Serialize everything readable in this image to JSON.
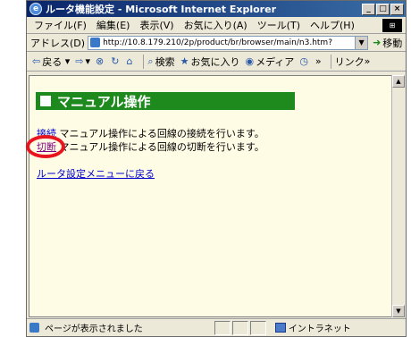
{
  "window": {
    "title": "ルータ機能設定 - Microsoft Internet Explorer",
    "buttons": [
      "_",
      "□",
      "×"
    ]
  },
  "menubar": {
    "items": [
      "ファイル(F)",
      "編集(E)",
      "表示(V)",
      "お気に入り(A)",
      "ツール(T)",
      "ヘルプ(H)"
    ]
  },
  "addressbar": {
    "label": "アドレス(D)",
    "url": "http://10.8.179.210/2p/product/br/browser/main/n3.htm?",
    "go_label": "移動"
  },
  "toolbar": {
    "back": "戻る",
    "search": "検索",
    "favorites": "お気に入り",
    "media": "メディア",
    "links": "リンク"
  },
  "content": {
    "heading": "マニュアル操作",
    "connect_link": "接続",
    "connect_desc": "マニュアル操作による回線の接続を行います。",
    "disconnect_link": "切断",
    "disconnect_desc": "マニュアル操作による回線の切断を行います。",
    "back_link": "ルータ設定メニューに戻る"
  },
  "statusbar": {
    "text": "ページが表示されました",
    "zone": "イントラネット"
  },
  "colors": {
    "heading_bg": "#1e8a1e",
    "highlight_ring": "#e8141e",
    "page_bg": "#fffce6"
  }
}
